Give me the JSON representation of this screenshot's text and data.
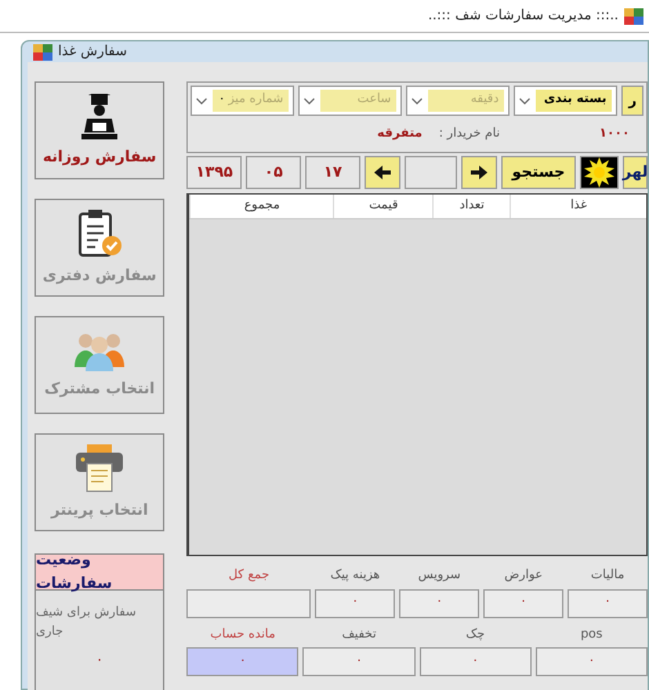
{
  "window": {
    "title": "..::: مدیریت سفارشات شف :::.."
  },
  "form": {
    "title": "سفارش غذا"
  },
  "side_buttons": [
    {
      "kind": "chef",
      "label": "سفارش روزانه",
      "disabled": false
    },
    {
      "kind": "clipboard",
      "label": "سفارش دفتری",
      "disabled": true
    },
    {
      "kind": "users",
      "label": "انتخاب مشترک",
      "disabled": true
    },
    {
      "kind": "printer",
      "label": "انتخاب پرینتر",
      "disabled": true
    }
  ],
  "order_status": {
    "title": "وضعیت سفارشات",
    "caption": "سفارش برای شیف جاری",
    "count": "۰"
  },
  "selectors": [
    {
      "kind": "field",
      "value": "ر",
      "disabled": false
    },
    {
      "kind": "combo",
      "value": "بسته بندی",
      "disabled": false
    },
    {
      "kind": "combo",
      "placeholder": "دقیقه",
      "disabled": true
    },
    {
      "kind": "combo",
      "placeholder": "ساعت",
      "disabled": true
    },
    {
      "kind": "combo",
      "placeholder": "شماره میز",
      "value": "۰",
      "disabled": true
    }
  ],
  "customer": {
    "code": "۱۰۰۰",
    "label": "نام خریدار :",
    "name": "متفرقه"
  },
  "toolbar": [
    {
      "kind": "text",
      "label": "لهر"
    },
    {
      "kind": "sun"
    },
    {
      "kind": "button",
      "label": "جستجو"
    },
    {
      "kind": "arrow-right"
    },
    {
      "kind": "blank"
    },
    {
      "kind": "arrow-left"
    },
    {
      "kind": "date",
      "label": "۱۷"
    },
    {
      "kind": "date",
      "label": "۰۵"
    },
    {
      "kind": "date",
      "label": "۱۳۹۵"
    }
  ],
  "table": {
    "columns": [
      "غذا",
      "تعداد",
      "قیمت",
      "مجموع"
    ]
  },
  "totals": [
    {
      "label": "مالیات",
      "value": "۰",
      "emphasis": false
    },
    {
      "label": "عوارض",
      "value": "۰",
      "emphasis": false
    },
    {
      "label": "سرویس",
      "value": "۰",
      "emphasis": false
    },
    {
      "label": "هزینه پیک",
      "value": "۰",
      "emphasis": false
    },
    {
      "label": "جمع کل",
      "emphasis": true
    }
  ],
  "payments": [
    {
      "label": "pos",
      "value": "۰",
      "emphasis": false,
      "focused": false
    },
    {
      "label": "چک",
      "value": "۰",
      "emphasis": false,
      "focused": false
    },
    {
      "label": "تخفیف",
      "value": "۰",
      "emphasis": false,
      "focused": false
    },
    {
      "label": "مانده حساب",
      "value": "۰",
      "emphasis": true,
      "focused": true
    }
  ]
}
